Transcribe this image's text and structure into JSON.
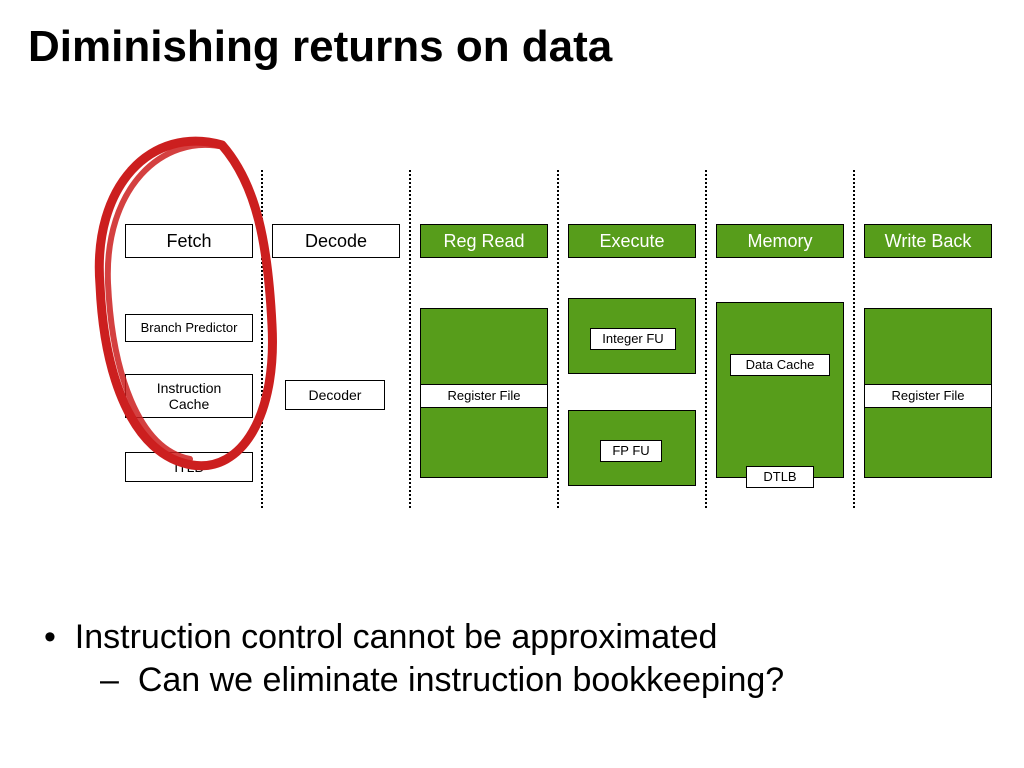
{
  "title": "Diminishing returns on data",
  "stages": {
    "fetch": "Fetch",
    "decode": "Decode",
    "regread": "Reg Read",
    "execute": "Execute",
    "memory": "Memory",
    "writeback": "Write Back"
  },
  "boxes": {
    "branch_predictor": "Branch Predictor",
    "instruction_cache": "Instruction\nCache",
    "itlb": "ITLB",
    "decoder": "Decoder",
    "register_file_left": "Register File",
    "integer_fu": "Integer FU",
    "fp_fu": "FP FU",
    "data_cache": "Data Cache",
    "dtlb": "DTLB",
    "register_file_right": "Register File"
  },
  "bullets": {
    "line1": "Instruction control cannot be approximated",
    "line2": "Can we eliminate instruction bookkeeping?"
  }
}
